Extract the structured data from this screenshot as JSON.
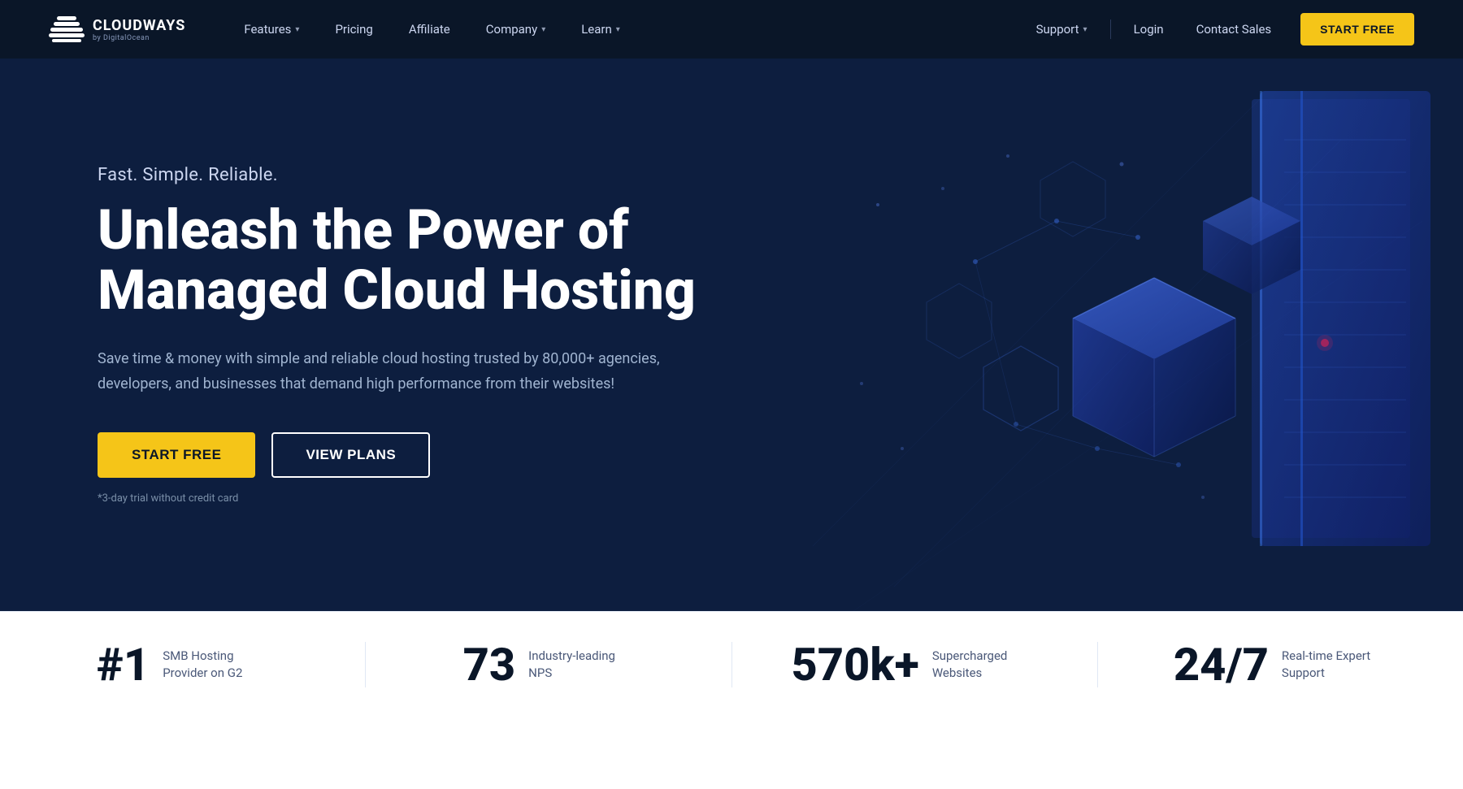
{
  "brand": {
    "name": "CLOUDWAYS",
    "subtitle": "by DigitalOcean",
    "logo_alt": "Cloudways logo"
  },
  "nav": {
    "links": [
      {
        "label": "Features",
        "has_dropdown": true,
        "id": "features"
      },
      {
        "label": "Pricing",
        "has_dropdown": false,
        "id": "pricing"
      },
      {
        "label": "Affiliate",
        "has_dropdown": false,
        "id": "affiliate"
      },
      {
        "label": "Company",
        "has_dropdown": true,
        "id": "company"
      },
      {
        "label": "Learn",
        "has_dropdown": true,
        "id": "learn"
      }
    ],
    "right_links": [
      {
        "label": "Support",
        "has_dropdown": true,
        "id": "support"
      },
      {
        "label": "Login",
        "has_dropdown": false,
        "id": "login"
      },
      {
        "label": "Contact Sales",
        "has_dropdown": false,
        "id": "contact-sales"
      }
    ],
    "cta_button": "START FREE"
  },
  "hero": {
    "tagline": "Fast. Simple. Reliable.",
    "title_line1": "Unleash the Power of",
    "title_line2": "Managed Cloud Hosting",
    "description": "Save time & money with simple and reliable cloud hosting trusted by 80,000+ agencies, developers, and businesses that demand high performance from their websites!",
    "cta_primary": "START FREE",
    "cta_secondary": "VIEW PLANS",
    "trial_note": "*3-day trial without credit card"
  },
  "stats": [
    {
      "number": "#1",
      "description": "SMB Hosting Provider on G2"
    },
    {
      "number": "73",
      "description": "Industry-leading NPS"
    },
    {
      "number": "570k+",
      "description": "Supercharged Websites"
    },
    {
      "number": "24/7",
      "description": "Real-time Expert Support"
    }
  ],
  "colors": {
    "bg_dark": "#0d1e3f",
    "bg_navbar": "#0a1628",
    "cta_yellow": "#f5c518",
    "text_light": "#ccd6f0",
    "text_muted": "#7a8fa8",
    "white": "#ffffff",
    "stats_bg": "#ffffff",
    "stat_border": "#e0e8f4"
  }
}
